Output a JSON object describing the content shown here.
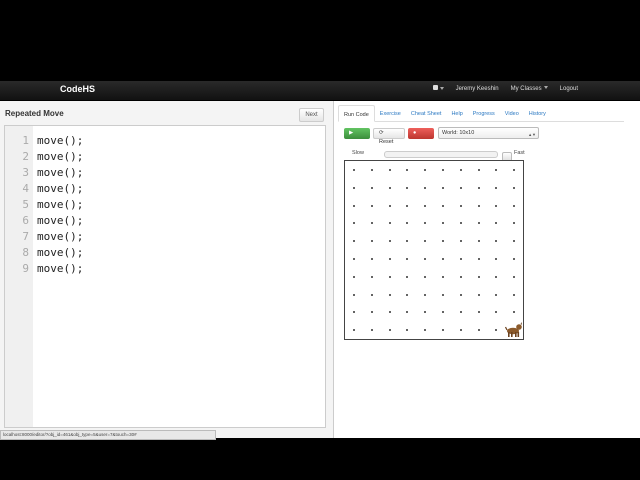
{
  "navbar": {
    "brand": "CodeHS",
    "user": "Jeremy Keeshin",
    "my_classes": "My Classes",
    "logout": "Logout"
  },
  "editor": {
    "title": "Repeated Move",
    "next_label": "Next",
    "lines": [
      {
        "num": "1",
        "text": "move();"
      },
      {
        "num": "2",
        "text": "move();"
      },
      {
        "num": "3",
        "text": "move();"
      },
      {
        "num": "4",
        "text": "move();"
      },
      {
        "num": "5",
        "text": "move();"
      },
      {
        "num": "6",
        "text": "move();"
      },
      {
        "num": "7",
        "text": "move();"
      },
      {
        "num": "8",
        "text": "move();"
      },
      {
        "num": "9",
        "text": "move();"
      }
    ]
  },
  "status_url": "localhost:8000/editor/?obj_id=461&obj_type=5&user=7&touch=30#",
  "right": {
    "tabs": [
      "Run Code",
      "Exercise",
      "Cheat Sheet",
      "Help",
      "Progress",
      "Video",
      "History"
    ],
    "run_label": "Run!",
    "reset_label": "Reset",
    "help_label": "Help",
    "world_label": "World: 10x10",
    "slow_label": "Slow",
    "fast_label": "Fast"
  },
  "world": {
    "rows": 10,
    "cols": 10,
    "karel_col": 10,
    "karel_row": 1
  },
  "colors": {
    "run": "#51a351",
    "help": "#bd362f",
    "link": "#2a78c2",
    "navbar": "#1b1b1b"
  }
}
